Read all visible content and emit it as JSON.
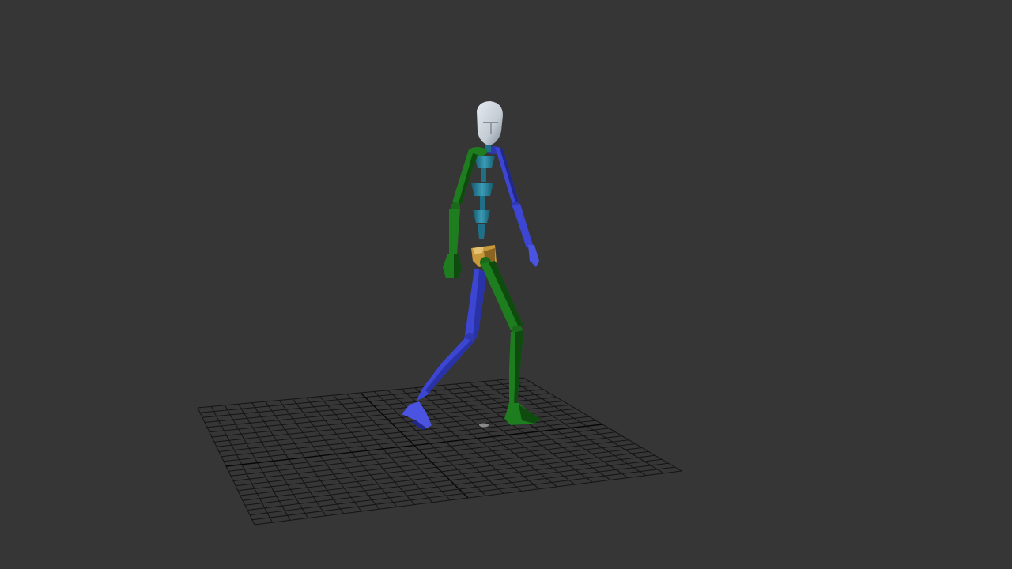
{
  "viewport": {
    "background": "#363636",
    "grid_color": "#141414",
    "grid_axis_color": "#060606"
  },
  "biped": {
    "left_side_color": "#1e7d1e",
    "left_side_shadow": "#0f4a0f",
    "right_side_color": "#3c46d2",
    "right_side_shadow": "#22288a",
    "spine_color": "#1f6f86",
    "spine_light": "#3a9cb6",
    "pelvis_color": "#c8993a",
    "head_color": "#c4ccd4",
    "head_shadow": "#7f8896"
  }
}
